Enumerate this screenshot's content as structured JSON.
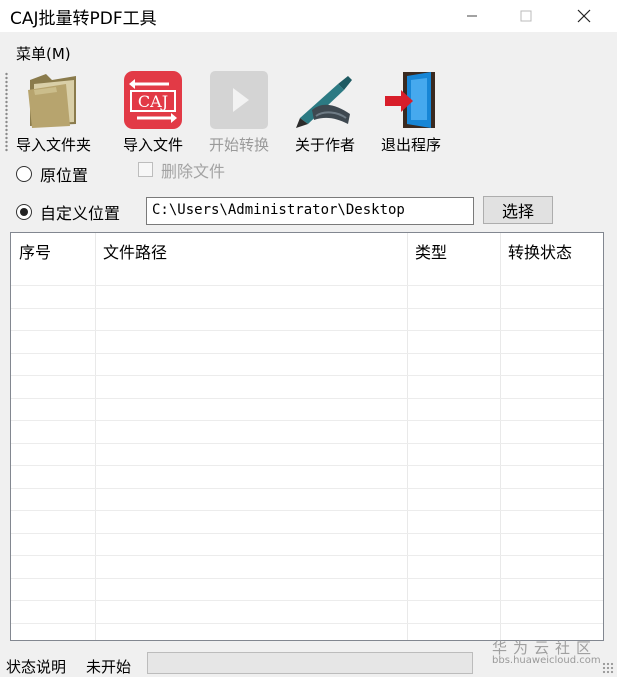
{
  "window": {
    "title": "CAJ批量转PDF工具"
  },
  "menu": {
    "label": "菜单(M)"
  },
  "toolbar": {
    "items": [
      {
        "label": "导入文件夹",
        "icon": "folder-icon",
        "enabled": true
      },
      {
        "label": "导入文件",
        "icon": "caj-icon",
        "enabled": true,
        "icon_text": "CAJ"
      },
      {
        "label": "开始转换",
        "icon": "play-icon",
        "enabled": false
      },
      {
        "label": "关于作者",
        "icon": "pen-icon",
        "enabled": true
      },
      {
        "label": "退出程序",
        "icon": "exit-door-icon",
        "enabled": true
      }
    ]
  },
  "options": {
    "original_location": {
      "label": "原位置",
      "checked": false
    },
    "delete_files": {
      "label": "删除文件",
      "checked": false,
      "enabled": false
    },
    "custom_location": {
      "label": "自定义位置",
      "checked": true
    },
    "path_value": "C:\\Users\\Administrator\\Desktop",
    "choose_button": "选择"
  },
  "table": {
    "columns": [
      "序号",
      "文件路径",
      "类型",
      "转换状态"
    ],
    "rows": []
  },
  "status": {
    "label": "状态说明",
    "value": "未开始"
  },
  "watermark": {
    "main": "华为云社区",
    "sub": "bbs.huaweicloud.com"
  },
  "colors": {
    "caj_red": "#e23a46",
    "disabled_gray": "#cfcfcf",
    "folder": "#b7a46e"
  }
}
